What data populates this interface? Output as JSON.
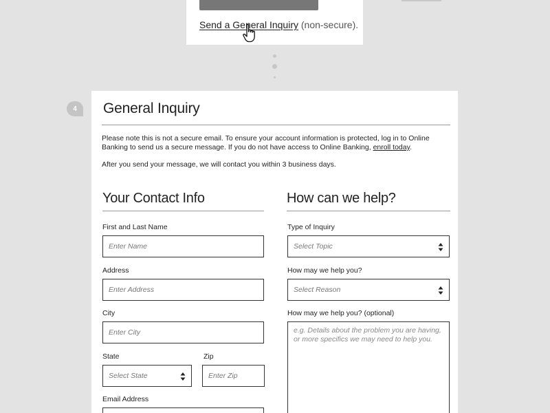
{
  "previous_step": {
    "link_text": "Send a General Inquiry",
    "link_suffix": "(non-secure)."
  },
  "step": {
    "number": "4"
  },
  "card": {
    "title": "General Inquiry",
    "notice_text": "Please note this is not a secure email. To ensure your account information is protected, log in to Online Banking to send us a secure message. If you do not have access to Online Banking,",
    "notice_link": "enroll today",
    "notice_end": ".",
    "followup_text": "After you send your message, we will contact you within 3 business days."
  },
  "contact": {
    "section_title": "Your Contact Info",
    "name_label": "First and Last Name",
    "name_placeholder": "Enter Name",
    "address_label": "Address",
    "address_placeholder": "Enter Address",
    "city_label": "City",
    "city_placeholder": "Enter City",
    "state_label": "State",
    "state_placeholder": "Select State",
    "zip_label": "Zip",
    "zip_placeholder": "Enter Zip",
    "email_label": "Email Address"
  },
  "help": {
    "section_title": "How can we help?",
    "type_label": "Type of Inquiry",
    "type_placeholder": "Select Topic",
    "reason_label": "How may we help you?",
    "reason_placeholder": "Select Reason",
    "details_label": "How may we help you? (optional)",
    "details_placeholder": "e.g. Details about the problem you are having, or more specifics we may need to help you."
  },
  "icons": {
    "cursor": "hand-pointer-icon",
    "select_arrows": "up-down-arrows-icon",
    "lock": "lock-icon"
  }
}
